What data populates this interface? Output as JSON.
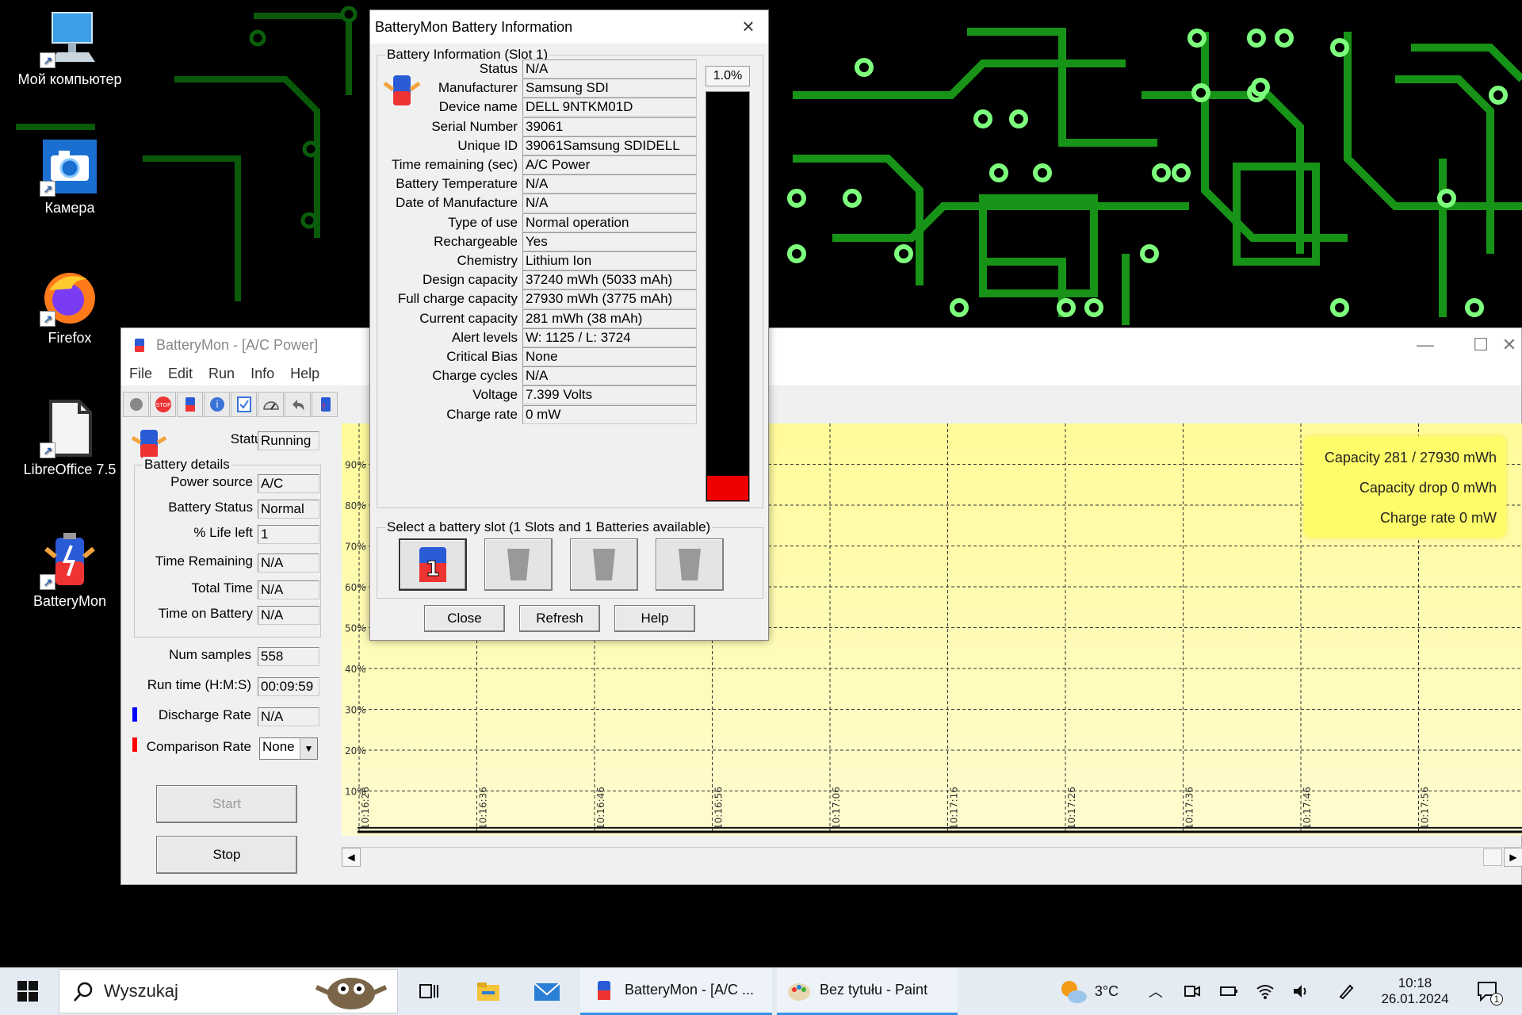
{
  "desktop": {
    "icons": [
      {
        "label": "Мой компьютер",
        "icon": "computer-icon"
      },
      {
        "label": "Камера",
        "icon": "camera-icon"
      },
      {
        "label": "Firefox",
        "icon": "firefox-icon"
      },
      {
        "label": "LibreOffice 7.5",
        "icon": "document-icon"
      },
      {
        "label": "BatteryMon",
        "icon": "battery-icon"
      }
    ]
  },
  "main_window": {
    "title": "BatteryMon - [A/C Power]",
    "menu": [
      "File",
      "Edit",
      "Run",
      "Info",
      "Help"
    ],
    "status_label": "Status",
    "status_value": "Running",
    "battery_details_title": "Battery details",
    "details": [
      {
        "label": "Power source",
        "value": "A/C"
      },
      {
        "label": "Battery Status",
        "value": "Normal"
      },
      {
        "label": "% Life left",
        "value": "1"
      },
      {
        "label": "Time Remaining",
        "value": "N/A"
      },
      {
        "label": "Total Time",
        "value": "N/A"
      },
      {
        "label": "Time on Battery",
        "value": "N/A"
      }
    ],
    "num_samples_label": "Num samples",
    "num_samples_value": "558",
    "run_time_label": "Run time (H:M:S)",
    "run_time_value": "00:09:59",
    "discharge_rate_label": "Discharge Rate",
    "discharge_rate_value": "N/A",
    "comparison_rate_label": "Comparison Rate",
    "comparison_rate_value": "None",
    "start_label": "Start",
    "stop_label": "Stop",
    "legend": {
      "capacity": "Capacity 281 / 27930 mWh",
      "capacity_drop": "Capacity drop 0 mWh",
      "charge_rate": "Charge rate 0 mW"
    },
    "colors": {
      "discharge": "#0000ff",
      "comparison": "#ff0000",
      "chart_bg": "#ffff9c"
    }
  },
  "chart_data": {
    "type": "line",
    "y_ticks": [
      "90%",
      "80%",
      "70%",
      "60%",
      "50%",
      "40%",
      "30%",
      "20%",
      "10%"
    ],
    "x_ticks": [
      "10:16:26",
      "10:16:36",
      "10:16:46",
      "10:16:56",
      "10:17:06",
      "10:17:16",
      "10:17:26",
      "10:17:36",
      "10:17:46",
      "10:17:56"
    ],
    "ylim": [
      0,
      100
    ],
    "grid": true,
    "series": [
      {
        "values": [
          1,
          1,
          1,
          1,
          1,
          1,
          1,
          1,
          1,
          1,
          1,
          1
        ]
      }
    ]
  },
  "info_dialog": {
    "title": "BatteryMon Battery Information",
    "group_title": "Battery Information (Slot 1)",
    "fields": [
      {
        "label": "Status",
        "value": "N/A"
      },
      {
        "label": "Manufacturer",
        "value": "Samsung SDI"
      },
      {
        "label": "Device name",
        "value": "DELL 9NTKM01D"
      },
      {
        "label": "Serial Number",
        "value": "39061"
      },
      {
        "label": "Unique ID",
        "value": "39061Samsung SDIDELL"
      },
      {
        "label": "Time remaining (sec)",
        "value": "A/C Power"
      },
      {
        "label": "Battery Temperature",
        "value": "N/A"
      },
      {
        "label": "Date of Manufacture",
        "value": "N/A"
      },
      {
        "label": "Type of use",
        "value": "Normal operation"
      },
      {
        "label": "Rechargeable",
        "value": "Yes"
      },
      {
        "label": "Chemistry",
        "value": "Lithium Ion"
      },
      {
        "label": "Design capacity",
        "value": "37240 mWh (5033 mAh)"
      },
      {
        "label": "Full charge capacity",
        "value": "27930 mWh (3775 mAh)"
      },
      {
        "label": "Current capacity",
        "value": "281 mWh (38 mAh)"
      },
      {
        "label": "Alert levels",
        "value": "W: 1125 / L: 3724"
      },
      {
        "label": "Critical Bias",
        "value": "None"
      },
      {
        "label": "Charge cycles",
        "value": "N/A"
      },
      {
        "label": "Voltage",
        "value": "7.399 Volts"
      },
      {
        "label": "Charge rate",
        "value": "0 mW"
      }
    ],
    "percent": "1.0%",
    "gauge_fraction": 0.06,
    "slot_group_title": "Select a battery slot (1 Slots and 1 Batteries available)",
    "slot_number": "1",
    "close_label": "Close",
    "refresh_label": "Refresh",
    "help_label": "Help"
  },
  "taskbar": {
    "search_placeholder": "Wyszukaj",
    "tasks": [
      {
        "label": "BatteryMon - [A/C ...",
        "icon": "battery-icon"
      },
      {
        "label": "Bez tytułu - Paint",
        "icon": "paint-icon"
      }
    ],
    "weather": "3°C",
    "time": "10:18",
    "date": "26.01.2024",
    "notification_count": "1"
  }
}
